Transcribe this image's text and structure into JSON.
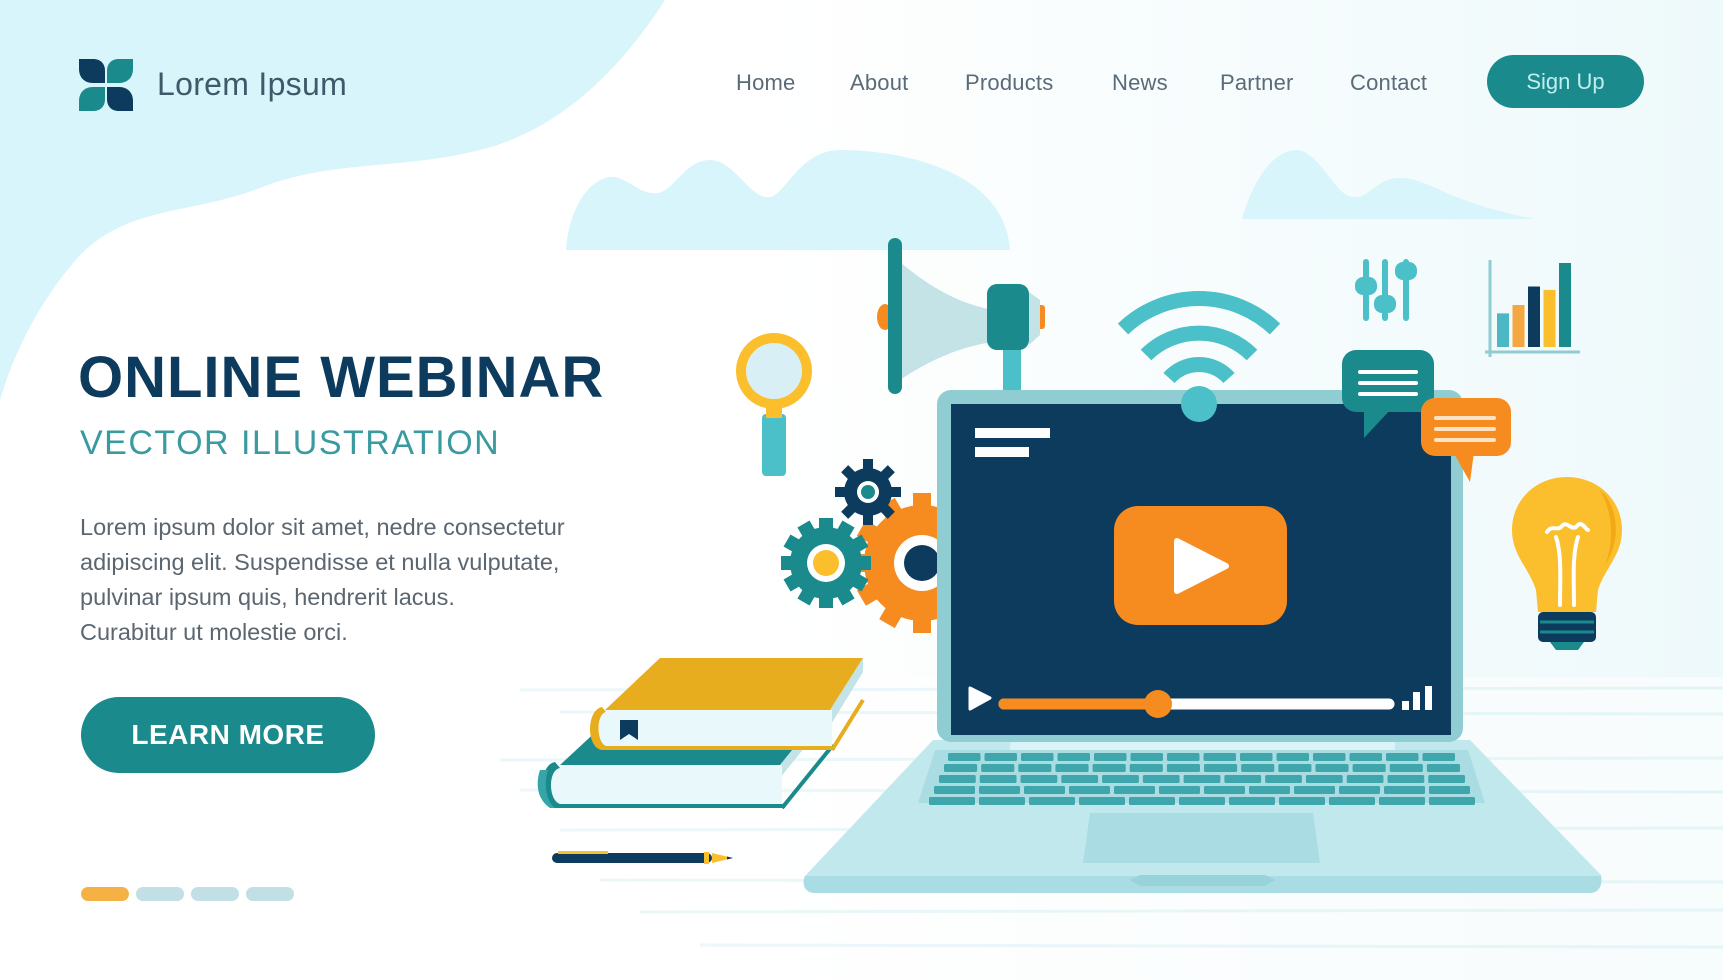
{
  "brand": {
    "name": "Lorem Ipsum",
    "logo_icon": "four-petal-logo-icon"
  },
  "nav": {
    "items": [
      {
        "label": "Home"
      },
      {
        "label": "About"
      },
      {
        "label": "Products"
      },
      {
        "label": "News"
      },
      {
        "label": "Partner"
      },
      {
        "label": "Contact"
      }
    ],
    "signup_label": "Sign Up"
  },
  "hero": {
    "title": "ONLINE WEBINAR",
    "subtitle": "VECTOR  ILLUSTRATION",
    "body_lines": [
      "Lorem ipsum dolor sit amet, nedre consectetur",
      "adipiscing elit. Suspendisse et nulla vulputate,",
      "pulvinar ipsum quis, hendrerit lacus.",
      "Curabitur ut molestie orci."
    ],
    "cta_label": "LEARN MORE"
  },
  "slider": {
    "count": 4,
    "active_index": 0
  },
  "illustration": {
    "video_player": {
      "progress": 0.4,
      "play_icon": "play-icon",
      "volume_icon": "volume-bars-icon"
    },
    "mini_chart_values": [
      0.4,
      0.5,
      0.72,
      0.68,
      1.0
    ],
    "icons": [
      "magnifier-icon",
      "megaphone-icon",
      "wifi-icon",
      "equalizer-sliders-icon",
      "bar-chart-icon",
      "chat-bubble-icon",
      "lightbulb-icon",
      "gears-icon",
      "books-icon",
      "pen-icon",
      "laptop-icon"
    ]
  },
  "colors": {
    "navy": "#0d3b5e",
    "teal": "#1b8a8c",
    "teal_light": "#4cc0c8",
    "orange": "#f68b1f",
    "yellow": "#fbbf2e",
    "sky": "#d8f5fb",
    "laptop": "#bfe6ea",
    "dot_inactive": "#c1dfe4",
    "dot_active": "#f6b145"
  }
}
